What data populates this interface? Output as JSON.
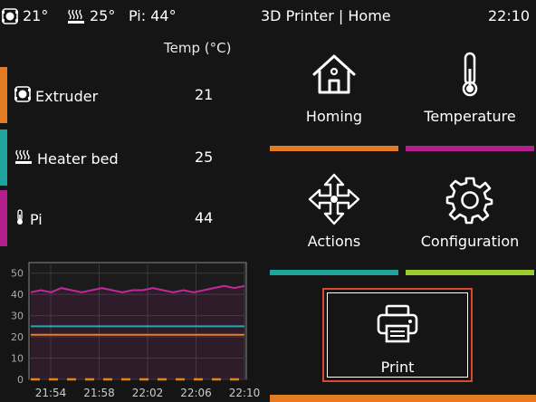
{
  "status_bar": {
    "extruder_temp": "21°",
    "bed_temp": "25°",
    "pi_temp": "Pi: 44°",
    "title": "3D Printer | Home",
    "clock": "22:10"
  },
  "temperatures": {
    "header": "Temp (°C)",
    "rows": [
      {
        "name": "Extruder",
        "value": "21",
        "color": "#e37b23",
        "icon": "extruder-icon"
      },
      {
        "name": "Heater bed",
        "value": "25",
        "color": "#1fa39a",
        "icon": "heater-bed-icon"
      },
      {
        "name": "Pi",
        "value": "44",
        "color": "#b51e8d",
        "icon": "thermometer-icon"
      }
    ]
  },
  "chart_data": {
    "type": "line",
    "title": "",
    "xlabel": "",
    "ylabel": "",
    "x_ticks": [
      "21:54",
      "21:58",
      "22:02",
      "22:06",
      "22:10"
    ],
    "y_ticks": [
      0,
      10,
      20,
      30,
      40,
      50
    ],
    "ylim": [
      0,
      55
    ],
    "xlim": [
      "21:52",
      "22:10"
    ],
    "grid": true,
    "series": [
      {
        "color": "#c2289c",
        "values": [
          41,
          42,
          41,
          43,
          42,
          41,
          42,
          43,
          42,
          41,
          42,
          42,
          43,
          42,
          41,
          42,
          41,
          42,
          43,
          44,
          43,
          44
        ]
      },
      {
        "color": "#25a9b0",
        "values": [
          25,
          25,
          25,
          25,
          25,
          25,
          25,
          25,
          25,
          25,
          25,
          25,
          25,
          25,
          25,
          25,
          25,
          25,
          25,
          25,
          25,
          25
        ]
      },
      {
        "color": "#e8801f",
        "values": [
          21,
          21,
          21,
          21,
          21,
          21,
          21,
          21,
          21,
          21,
          21,
          21,
          21,
          21,
          21,
          21,
          21,
          21,
          21,
          21,
          21,
          21
        ]
      },
      {
        "color": "#e8801f",
        "dashed": true,
        "values": [
          0,
          0,
          0,
          0,
          0,
          0,
          0,
          0,
          0,
          0,
          0,
          0,
          0,
          0,
          0,
          0,
          0,
          0,
          0,
          0,
          0,
          0
        ]
      }
    ]
  },
  "menu": {
    "homing": {
      "label": "Homing",
      "icon": "home-icon",
      "color": "#e37b23"
    },
    "temperature": {
      "label": "Temperature",
      "icon": "thermometer-icon",
      "color": "#b51e8d"
    },
    "actions": {
      "label": "Actions",
      "icon": "move-arrows-icon",
      "color": "#1fa39a"
    },
    "configuration": {
      "label": "Configuration",
      "icon": "gear-icon",
      "color": "#9ccd2f"
    },
    "print": {
      "label": "Print",
      "icon": "printer-icon",
      "color": "#e37b23",
      "border_color": "#d84a2e"
    }
  }
}
